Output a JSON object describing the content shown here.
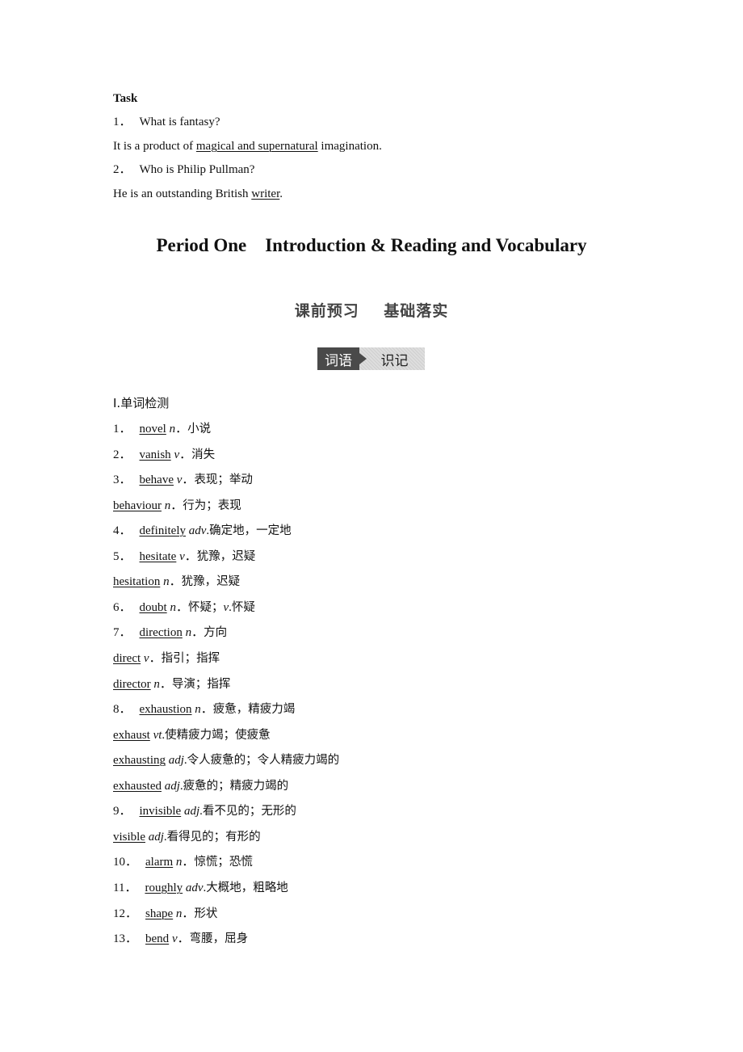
{
  "task": {
    "heading": "Task",
    "q1": {
      "num": "1．",
      "text": "What is fantasy?"
    },
    "a1": {
      "prefix": "It is a product of ",
      "answer": "magical and supernatural",
      "suffix": " imagination."
    },
    "q2": {
      "num": "2．",
      "text": "Who is Philip Pullman?"
    },
    "a2": {
      "prefix": "He is an outstanding British ",
      "answer": "writer",
      "suffix": "."
    }
  },
  "period_title": "Period One    Introduction & Reading and Vocabulary",
  "section_title": "课前预习    基础落实",
  "banner": {
    "left": "词语",
    "right": "识记"
  },
  "vocab": {
    "heading": "Ⅰ.单词检测",
    "items": [
      {
        "num": "1．",
        "word": "novel",
        "pos": "n",
        "sep": "．",
        "meaning": "小说"
      },
      {
        "num": "2．",
        "word": "vanish",
        "pos": "v",
        "sep": "．",
        "meaning": "消失"
      },
      {
        "num": "3．",
        "word": "behave",
        "pos": "v",
        "sep": "．",
        "meaning": "表现；举动"
      },
      {
        "num": "",
        "word": "behaviour",
        "pos": "n",
        "sep": "．",
        "meaning": "行为；表现"
      },
      {
        "num": "4．",
        "word": "definitely",
        "pos": "adv",
        "sep": ".",
        "meaning": "确定地，一定地"
      },
      {
        "num": "5．",
        "word": "hesitate",
        "pos": "v",
        "sep": "．",
        "meaning": "犹豫，迟疑"
      },
      {
        "num": "",
        "word": "hesitation",
        "pos": "n",
        "sep": "．",
        "meaning": "犹豫，迟疑"
      },
      {
        "num": "6．",
        "word": "doubt",
        "pos": "n",
        "sep": "．",
        "meaning": "怀疑；",
        "pos2": "v",
        "sep2": ".",
        "meaning2": "怀疑"
      },
      {
        "num": "7．",
        "word": "direction",
        "pos": "n",
        "sep": "．",
        "meaning": "方向"
      },
      {
        "num": "",
        "word": "direct",
        "pos": "v",
        "sep": "．",
        "meaning": "指引；指挥"
      },
      {
        "num": "",
        "word": "director",
        "pos": "n",
        "sep": "．",
        "meaning": "导演；指挥"
      },
      {
        "num": "8．",
        "word": "exhaustion",
        "pos": "n",
        "sep": "．",
        "meaning": "疲惫，精疲力竭"
      },
      {
        "num": "",
        "word": "exhaust",
        "pos": "vt",
        "sep": ".",
        "meaning": "使精疲力竭；使疲惫"
      },
      {
        "num": "",
        "word": "exhausting",
        "pos": "adj",
        "sep": ".",
        "meaning": "令人疲惫的；令人精疲力竭的"
      },
      {
        "num": "",
        "word": "exhausted",
        "pos": "adj",
        "sep": ".",
        "meaning": "疲惫的；精疲力竭的"
      },
      {
        "num": "9．",
        "word": "invisible",
        "pos": "adj",
        "sep": ".",
        "meaning": "看不见的；无形的"
      },
      {
        "num": "",
        "word": "visible",
        "pos": "adj",
        "sep": ".",
        "meaning": "看得见的；有形的"
      },
      {
        "num": "10．",
        "word": "alarm",
        "pos": "n",
        "sep": "．",
        "meaning": "惊慌；恐慌"
      },
      {
        "num": "11．",
        "word": "roughly",
        "pos": "adv",
        "sep": ".",
        "meaning": "大概地，粗略地"
      },
      {
        "num": "12．",
        "word": "shape",
        "pos": "n",
        "sep": "．",
        "meaning": "形状"
      },
      {
        "num": "13．",
        "word": "bend",
        "pos": "v",
        "sep": "．",
        "meaning": "弯腰，屈身"
      }
    ]
  }
}
